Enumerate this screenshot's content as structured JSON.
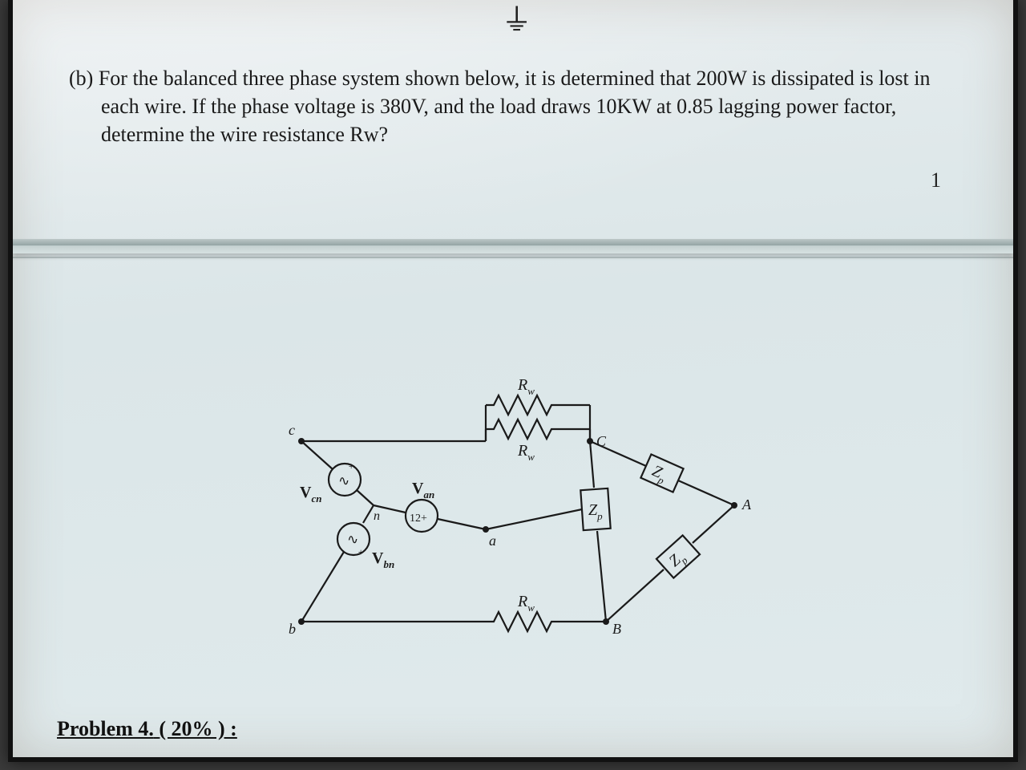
{
  "top_marker": "⏚",
  "problem": {
    "label": "(b)",
    "text": "For the balanced three phase system shown below, it is determined that 200W is dissipated is lost in each wire. If the phase voltage is 380V, and the load draws 10KW at 0.85 lagging power factor, determine the wire resistance Rw?"
  },
  "page_number": "1",
  "circuit": {
    "source_nodes": {
      "c": "c",
      "n": "n",
      "a": "a",
      "b": "b"
    },
    "load_nodes": {
      "C": "C",
      "A": "A",
      "B": "B"
    },
    "sources": {
      "Vcn": "V",
      "Vcn_sub": "cn",
      "Van": "V",
      "Van_sub": "an",
      "Vbn": "V",
      "Vbn_sub": "bn",
      "handwritten": "12+"
    },
    "resistor_label": "R",
    "resistor_sub": "w",
    "load_label": "Z",
    "load_sub": "p"
  },
  "next_problem": {
    "title": "Problem 4.",
    "weight": "( 20% )  :"
  }
}
